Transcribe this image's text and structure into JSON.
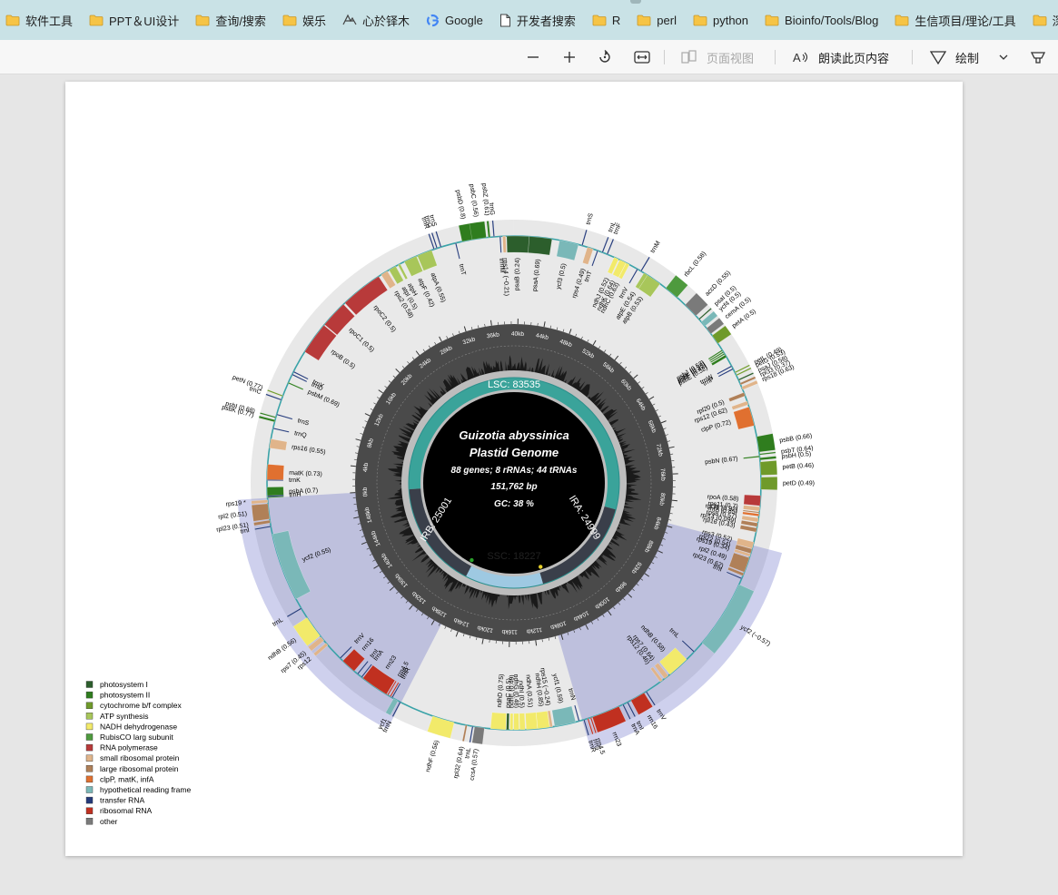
{
  "bookmarks": [
    {
      "label": "软件工具",
      "icon": "folder-icon"
    },
    {
      "label": "PPT＆UI设计",
      "icon": "folder-icon"
    },
    {
      "label": "查询/搜索",
      "icon": "folder-icon"
    },
    {
      "label": "娱乐",
      "icon": "folder-icon"
    },
    {
      "label": "心於铎木",
      "icon": "site-logo-icon"
    },
    {
      "label": "Google",
      "icon": "google-icon"
    },
    {
      "label": "开发者搜索",
      "icon": "page-icon"
    },
    {
      "label": "R",
      "icon": "folder-icon"
    },
    {
      "label": "perl",
      "icon": "folder-icon"
    },
    {
      "label": "python",
      "icon": "folder-icon"
    },
    {
      "label": "Bioinfo/Tools/Blog",
      "icon": "folder-icon"
    },
    {
      "label": "生信项目/理论/工具",
      "icon": "folder-icon"
    },
    {
      "label": "深度学习",
      "icon": "folder-icon"
    }
  ],
  "toolbar": {
    "page_view": "页面视图",
    "read_aloud": "朗读此页内容",
    "draw": "绘制"
  },
  "map": {
    "title_line1": "Guizotia abyssinica",
    "title_line2": "Plastid Genome",
    "counts": "88 genes; 8 rRNAs; 44 tRNAs",
    "length": "151,762 bp",
    "gc": "GC: 38 %",
    "lsc": "LSC: 83535",
    "ssc": "SSC: 18227",
    "irb": "IRB: 25001",
    "ira": "IRA: 24999",
    "total_bp": 151762,
    "kb_ticks": [
      "0kb",
      "4kb",
      "8kb",
      "12kb",
      "16kb",
      "20kb",
      "24kb",
      "28kb",
      "32kb",
      "36kb",
      "40kb",
      "44kb",
      "48kb",
      "52kb",
      "56kb",
      "60kb",
      "64kb",
      "68kb",
      "72kb",
      "76kb",
      "80kb",
      "84kb",
      "88kb",
      "92kb",
      "96kb",
      "100kb",
      "104kb",
      "108kb",
      "112kb",
      "116kb",
      "120kb",
      "124kb",
      "128kb",
      "132kb",
      "136kb",
      "140kb",
      "144kb",
      "148kb"
    ]
  },
  "colors": {
    "lsc": "#3aa39a",
    "ssc": "#9ec9e2",
    "ir": "#3a3f4a",
    "ir_shade": "#5e62c4",
    "gc_ring": "#4a4a4a",
    "backbone": "#3aa3a8"
  },
  "legend": [
    {
      "label": "photosystem I",
      "color": "#2c5e2c"
    },
    {
      "label": "photosystem II",
      "color": "#2f7d1e"
    },
    {
      "label": "cytochrome b/f complex",
      "color": "#6f9a2a"
    },
    {
      "label": "ATP synthesis",
      "color": "#a8c65a"
    },
    {
      "label": "NADH dehydrogenase",
      "color": "#f2ea6a"
    },
    {
      "label": "RubisCO larg subunit",
      "color": "#4e9a3e"
    },
    {
      "label": "RNA polymerase",
      "color": "#b83a3a"
    },
    {
      "label": "small ribosomal protein",
      "color": "#e0b48a"
    },
    {
      "label": "large ribosomal protein",
      "color": "#b08058"
    },
    {
      "label": "clpP, matK, infA",
      "color": "#e07030"
    },
    {
      "label": "hypothetical reading frame",
      "color": "#7ab8b8"
    },
    {
      "label": "transfer RNA",
      "color": "#243a7a"
    },
    {
      "label": "ribosomal RNA",
      "color": "#c03020"
    },
    {
      "label": "other",
      "color": "#7a7a7a"
    }
  ],
  "genes": [
    {
      "name": "psbA (0.7)",
      "start": 0,
      "len": 1060,
      "strand": "-",
      "cat": 1
    },
    {
      "name": "trnH",
      "start": 100,
      "len": 80,
      "strand": "-",
      "cat": 11
    },
    {
      "name": "trnK",
      "start": 1700,
      "len": 80,
      "strand": "-",
      "cat": 11
    },
    {
      "name": "matK (0.73)",
      "start": 1800,
      "len": 1500,
      "strand": "-",
      "cat": 9
    },
    {
      "name": "rps16 (0.55)",
      "start": 4900,
      "len": 900,
      "strand": "-",
      "cat": 7
    },
    {
      "name": "trnQ",
      "start": 6800,
      "len": 80,
      "strand": "-",
      "cat": 11
    },
    {
      "name": "psbK (0.77)",
      "start": 7500,
      "len": 200,
      "strand": "+",
      "cat": 1
    },
    {
      "name": "psbI (0.68)",
      "start": 7900,
      "len": 110,
      "strand": "+",
      "cat": 1
    },
    {
      "name": "trnS",
      "start": 8200,
      "len": 90,
      "strand": "-",
      "cat": 11
    },
    {
      "name": "trnC",
      "start": 9700,
      "len": 80,
      "strand": "+",
      "cat": 11
    },
    {
      "name": "petN (0.77)",
      "start": 10100,
      "len": 90,
      "strand": "+",
      "cat": 2
    },
    {
      "name": "psbM (0.69)",
      "start": 11500,
      "len": 110,
      "strand": "-",
      "cat": 1
    },
    {
      "name": "trnD",
      "start": 12400,
      "len": 80,
      "strand": "-",
      "cat": 11
    },
    {
      "name": "trnY",
      "start": 12700,
      "len": 80,
      "strand": "-",
      "cat": 11
    },
    {
      "name": "rpoB (0.5)",
      "start": 15000,
      "len": 3200,
      "strand": "-",
      "cat": 6
    },
    {
      "name": "rpoC1 (0.5)",
      "start": 18300,
      "len": 2700,
      "strand": "-",
      "cat": 6
    },
    {
      "name": "rpoC2 (0.5)",
      "start": 21200,
      "len": 4200,
      "strand": "-",
      "cat": 6
    },
    {
      "name": "rps2 (0.58)",
      "start": 25700,
      "len": 700,
      "strand": "-",
      "cat": 7
    },
    {
      "name": "atpI (0.5)",
      "start": 26600,
      "len": 750,
      "strand": "-",
      "cat": 3
    },
    {
      "name": "atpH",
      "start": 27600,
      "len": 240,
      "strand": "-",
      "cat": 3
    },
    {
      "name": "atpF (0.42)",
      "start": 28300,
      "len": 1300,
      "strand": "-",
      "cat": 3
    },
    {
      "name": "atpA (0.55)",
      "start": 29700,
      "len": 1500,
      "strand": "-",
      "cat": 3
    },
    {
      "name": "trnR",
      "start": 31400,
      "len": 80,
      "strand": "+",
      "cat": 11
    },
    {
      "name": "trnG",
      "start": 31700,
      "len": 80,
      "strand": "+",
      "cat": 11
    },
    {
      "name": "trnS",
      "start": 32100,
      "len": 90,
      "strand": "+",
      "cat": 11
    },
    {
      "name": "trnT",
      "start": 33600,
      "len": 80,
      "strand": "-",
      "cat": 11
    },
    {
      "name": "psbD (0.8)",
      "start": 34300,
      "len": 1060,
      "strand": "+",
      "cat": 1
    },
    {
      "name": "psbC (0.56)",
      "start": 35300,
      "len": 1400,
      "strand": "+",
      "cat": 1
    },
    {
      "name": "psbZ (0.61)",
      "start": 36900,
      "len": 190,
      "strand": "+",
      "cat": 1
    },
    {
      "name": "trnG",
      "start": 37400,
      "len": 80,
      "strand": "+",
      "cat": 11
    },
    {
      "name": "trnfM",
      "start": 38000,
      "len": 80,
      "strand": "-",
      "cat": 11
    },
    {
      "name": "rps14 (−0.21)",
      "start": 38300,
      "len": 300,
      "strand": "-",
      "cat": 7
    },
    {
      "name": "psaB (0.24)",
      "start": 38700,
      "len": 2200,
      "strand": "-",
      "cat": 0
    },
    {
      "name": "psaA (0.69)",
      "start": 40900,
      "len": 2250,
      "strand": "-",
      "cat": 0
    },
    {
      "name": "ycf3 (0.5)",
      "start": 43900,
      "len": 1900,
      "strand": "-",
      "cat": 10
    },
    {
      "name": "trnS",
      "start": 46100,
      "len": 90,
      "strand": "+",
      "cat": 11
    },
    {
      "name": "rps4 (0.49)",
      "start": 46700,
      "len": 600,
      "strand": "-",
      "cat": 7
    },
    {
      "name": "trnT",
      "start": 47700,
      "len": 80,
      "strand": "-",
      "cat": 11
    },
    {
      "name": "trnL",
      "start": 48200,
      "len": 80,
      "strand": "+",
      "cat": 11
    },
    {
      "name": "trnF",
      "start": 48700,
      "len": 80,
      "strand": "+",
      "cat": 11
    },
    {
      "name": "ndhJ (0.52)",
      "start": 49500,
      "len": 480,
      "strand": "-",
      "cat": 4
    },
    {
      "name": "ndhK (0.64)",
      "start": 50100,
      "len": 680,
      "strand": "-",
      "cat": 4
    },
    {
      "name": "ndhC (0.63)",
      "start": 50800,
      "len": 360,
      "strand": "-",
      "cat": 4
    },
    {
      "name": "trnV",
      "start": 52000,
      "len": 80,
      "strand": "-",
      "cat": 11
    },
    {
      "name": "trnM",
      "start": 52400,
      "len": 80,
      "strand": "+",
      "cat": 11
    },
    {
      "name": "atpE (0.54)",
      "start": 52800,
      "len": 400,
      "strand": "-",
      "cat": 3
    },
    {
      "name": "atpB (0.53)",
      "start": 53200,
      "len": 1500,
      "strand": "-",
      "cat": 3
    },
    {
      "name": "rbcL (0.58)",
      "start": 55400,
      "len": 1430,
      "strand": "+",
      "cat": 5
    },
    {
      "name": "accD (0.55)",
      "start": 57900,
      "len": 1500,
      "strand": "+",
      "cat": 13
    },
    {
      "name": "psaI (0.5)",
      "start": 59800,
      "len": 110,
      "strand": "+",
      "cat": 0
    },
    {
      "name": "ycf4 (0.5)",
      "start": 60200,
      "len": 550,
      "strand": "+",
      "cat": 10
    },
    {
      "name": "cemA (0.5)",
      "start": 61000,
      "len": 690,
      "strand": "+",
      "cat": 13
    },
    {
      "name": "petA (0.5)",
      "start": 61900,
      "len": 960,
      "strand": "+",
      "cat": 2
    },
    {
      "name": "psbJ (0.52)",
      "start": 63600,
      "len": 120,
      "strand": "-",
      "cat": 1
    },
    {
      "name": "psbL (0.53)",
      "start": 63800,
      "len": 120,
      "strand": "-",
      "cat": 1
    },
    {
      "name": "psbF (0.42)",
      "start": 64000,
      "len": 120,
      "strand": "-",
      "cat": 1
    },
    {
      "name": "psbE (0.52)",
      "start": 64200,
      "len": 250,
      "strand": "-",
      "cat": 1
    },
    {
      "name": "trnW",
      "start": 65400,
      "len": 80,
      "strand": "-",
      "cat": 11
    },
    {
      "name": "trnP",
      "start": 65700,
      "len": 80,
      "strand": "-",
      "cat": 11
    },
    {
      "name": "petL (0.49)",
      "start": 66100,
      "len": 100,
      "strand": "+",
      "cat": 2
    },
    {
      "name": "petG (0.53)",
      "start": 66400,
      "len": 120,
      "strand": "+",
      "cat": 2
    },
    {
      "name": "psaJ (0.58)",
      "start": 66900,
      "len": 130,
      "strand": "+",
      "cat": 0
    },
    {
      "name": "rpl33 (0.37)",
      "start": 67300,
      "len": 200,
      "strand": "+",
      "cat": 8
    },
    {
      "name": "rps18 (0.63)",
      "start": 67700,
      "len": 310,
      "strand": "+",
      "cat": 7
    },
    {
      "name": "rpl20 (0.5)",
      "start": 68300,
      "len": 360,
      "strand": "-",
      "cat": 8
    },
    {
      "name": "rps12 (0.62)",
      "start": 69200,
      "len": 370,
      "strand": "-",
      "cat": 7
    },
    {
      "name": "clpP (0.72)",
      "start": 69800,
      "len": 1900,
      "strand": "-",
      "cat": 9
    },
    {
      "name": "psbB (0.66)",
      "start": 72800,
      "len": 1530,
      "strand": "+",
      "cat": 1
    },
    {
      "name": "psbT (0.64)",
      "start": 74500,
      "len": 110,
      "strand": "+",
      "cat": 1
    },
    {
      "name": "psbN (0.67)",
      "start": 74700,
      "len": 130,
      "strand": "-",
      "cat": 1
    },
    {
      "name": "psbH (0.5)",
      "start": 74900,
      "len": 220,
      "strand": "+",
      "cat": 1
    },
    {
      "name": "petB (0.46)",
      "start": 75300,
      "len": 1300,
      "strand": "+",
      "cat": 2
    },
    {
      "name": "petD (0.49)",
      "start": 76800,
      "len": 1200,
      "strand": "+",
      "cat": 2
    },
    {
      "name": "rpoA (0.58)",
      "start": 78600,
      "len": 1000,
      "strand": "-",
      "cat": 6
    },
    {
      "name": "rps11 (0.7)",
      "start": 79700,
      "len": 420,
      "strand": "-",
      "cat": 7
    },
    {
      "name": "rpl36 (0.92)",
      "start": 80200,
      "len": 120,
      "strand": "-",
      "cat": 8
    },
    {
      "name": "infA (0.85)",
      "start": 80400,
      "len": 230,
      "strand": "-",
      "cat": 9
    },
    {
      "name": "rps8 (0.57)",
      "start": 80800,
      "len": 400,
      "strand": "-",
      "cat": 7
    },
    {
      "name": "rpl14 (0.099)",
      "start": 81300,
      "len": 370,
      "strand": "-",
      "cat": 8
    },
    {
      "name": "rpl16 (0.43)",
      "start": 81800,
      "len": 400,
      "strand": "-",
      "cat": 8
    },
    {
      "name": "rps3 (0.52)",
      "start": 83200,
      "len": 660,
      "strand": "-",
      "cat": 7
    },
    {
      "name": "rpl22 (0.54)",
      "start": 83900,
      "len": 460,
      "strand": "-",
      "cat": 8
    },
    {
      "name": "rps19 (0.34)",
      "start": 84400,
      "len": 280,
      "strand": "-",
      "cat": 7
    },
    {
      "name": "rpl2 (0.49)",
      "start": 84800,
      "len": 1500,
      "strand": "-",
      "cat": 8
    },
    {
      "name": "rpl23 (0.62)",
      "start": 86400,
      "len": 280,
      "strand": "-",
      "cat": 8
    },
    {
      "name": "trnI",
      "start": 86900,
      "len": 80,
      "strand": "-",
      "cat": 11
    },
    {
      "name": "ycf2 (−0.57)",
      "start": 87600,
      "len": 6800,
      "strand": "+",
      "cat": 10
    },
    {
      "name": "trnL",
      "start": 95500,
      "len": 80,
      "strand": "-",
      "cat": 11
    },
    {
      "name": "ndhB (0.58)",
      "start": 96600,
      "len": 2200,
      "strand": "-",
      "cat": 4
    },
    {
      "name": "rps7 (0.64)",
      "start": 99000,
      "len": 470,
      "strand": "-",
      "cat": 7
    },
    {
      "name": "rps12 (0.46)",
      "start": 99700,
      "len": 300,
      "strand": "-",
      "cat": 7
    },
    {
      "name": "trnV",
      "start": 101600,
      "len": 80,
      "strand": "+",
      "cat": 11
    },
    {
      "name": "rrn16",
      "start": 101900,
      "len": 1490,
      "strand": "+",
      "cat": 12
    },
    {
      "name": "trnI",
      "start": 103700,
      "len": 80,
      "strand": "+",
      "cat": 11
    },
    {
      "name": "trnA",
      "start": 104200,
      "len": 80,
      "strand": "+",
      "cat": 11
    },
    {
      "name": "rrn23",
      "start": 104700,
      "len": 2800,
      "strand": "+",
      "cat": 12
    },
    {
      "name": "rrn4.5",
      "start": 107600,
      "len": 100,
      "strand": "+",
      "cat": 12
    },
    {
      "name": "rrn5",
      "start": 107900,
      "len": 120,
      "strand": "+",
      "cat": 12
    },
    {
      "name": "trnR",
      "start": 108300,
      "len": 80,
      "strand": "+",
      "cat": 11
    },
    {
      "name": "trnN",
      "start": 108800,
      "len": 80,
      "strand": "-",
      "cat": 11
    },
    {
      "name": "ycf1 (0.59)",
      "start": 109200,
      "len": 2100,
      "strand": "-",
      "cat": 10
    },
    {
      "name": "rps15 (−0.24)",
      "start": 111500,
      "len": 270,
      "strand": "-",
      "cat": 7
    },
    {
      "name": "ndhH (0.85)",
      "start": 111800,
      "len": 1180,
      "strand": "-",
      "cat": 4
    },
    {
      "name": "ndhA (0.51)",
      "start": 113000,
      "len": 1100,
      "strand": "-",
      "cat": 4
    },
    {
      "name": "ndhI (0.5)",
      "start": 114200,
      "len": 540,
      "strand": "-",
      "cat": 4
    },
    {
      "name": "ndhG (0.48)",
      "start": 114800,
      "len": 530,
      "strand": "-",
      "cat": 4
    },
    {
      "name": "ndhE (0.49)",
      "start": 115400,
      "len": 300,
      "strand": "-",
      "cat": 4
    },
    {
      "name": "psaC (0.5)",
      "start": 115800,
      "len": 250,
      "strand": "-",
      "cat": 0
    },
    {
      "name": "ndhD (0.75)",
      "start": 116100,
      "len": 1500,
      "strand": "-",
      "cat": 4
    },
    {
      "name": "ccsA (0.57)",
      "start": 118200,
      "len": 960,
      "strand": "+",
      "cat": 13
    },
    {
      "name": "trnL",
      "start": 119300,
      "len": 80,
      "strand": "+",
      "cat": 11
    },
    {
      "name": "rpl32 (0.64)",
      "start": 119900,
      "len": 170,
      "strand": "+",
      "cat": 8
    },
    {
      "name": "ndhF (0.56)",
      "start": 121200,
      "len": 2200,
      "strand": "+",
      "cat": 4
    },
    {
      "name": "trnN",
      "start": 126800,
      "len": 80,
      "strand": "+",
      "cat": 11
    },
    {
      "name": "ycf1",
      "start": 127100,
      "len": 500,
      "strand": "+",
      "cat": 10
    },
    {
      "name": "trnR",
      "start": 127700,
      "len": 80,
      "strand": "-",
      "cat": 11
    },
    {
      "name": "rrn5",
      "start": 127900,
      "len": 120,
      "strand": "-",
      "cat": 12
    },
    {
      "name": "rrn4.5",
      "start": 128200,
      "len": 100,
      "strand": "-",
      "cat": 12
    },
    {
      "name": "rrn23",
      "start": 128400,
      "len": 2800,
      "strand": "-",
      "cat": 12
    },
    {
      "name": "trnA",
      "start": 131300,
      "len": 80,
      "strand": "-",
      "cat": 11
    },
    {
      "name": "trnI",
      "start": 131800,
      "len": 80,
      "strand": "-",
      "cat": 11
    },
    {
      "name": "rrn16",
      "start": 132300,
      "len": 1490,
      "strand": "-",
      "cat": 12
    },
    {
      "name": "trnV",
      "start": 134100,
      "len": 80,
      "strand": "-",
      "cat": 11
    },
    {
      "name": "rps12",
      "start": 135900,
      "len": 300,
      "strand": "+",
      "cat": 7
    },
    {
      "name": "rps7 (0.45)",
      "start": 136500,
      "len": 470,
      "strand": "+",
      "cat": 7
    },
    {
      "name": "ndhB (0.56)",
      "start": 137100,
      "len": 2200,
      "strand": "+",
      "cat": 4
    },
    {
      "name": "trnL",
      "start": 140300,
      "len": 80,
      "strand": "+",
      "cat": 11
    },
    {
      "name": "ycf2 (0.55)",
      "start": 141400,
      "len": 6800,
      "strand": "-",
      "cat": 10
    },
    {
      "name": "trnI",
      "start": 148900,
      "len": 80,
      "strand": "+",
      "cat": 11
    },
    {
      "name": "rpl23 (0.51)",
      "start": 149300,
      "len": 280,
      "strand": "+",
      "cat": 8
    },
    {
      "name": "rpl2 (0.51)",
      "start": 149700,
      "len": 1500,
      "strand": "+",
      "cat": 8
    },
    {
      "name": "rps19 *",
      "start": 151300,
      "len": 280,
      "strand": "+",
      "cat": 7
    }
  ]
}
